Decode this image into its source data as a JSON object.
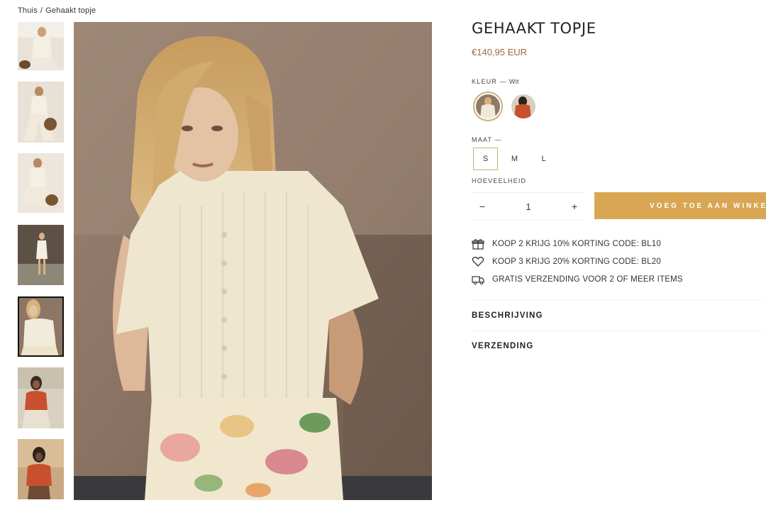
{
  "breadcrumb": {
    "home": "Thuis",
    "separator": "/",
    "current": "Gehaakt topje"
  },
  "product": {
    "title": "GEHAAKT TOPJE",
    "price": "€140,95 EUR"
  },
  "color": {
    "label": "KLEUR —",
    "selected_value": "Wit",
    "options": [
      "Wit",
      "Rood"
    ]
  },
  "size": {
    "label": "MAAT —",
    "options": [
      "S",
      "M",
      "L"
    ],
    "selected": "S"
  },
  "quantity": {
    "label": "HOEVEELHEID",
    "minus": "−",
    "value": "1",
    "plus": "+"
  },
  "add_to_cart": {
    "label": "VOEG TOE AAN WINKELWAGEN"
  },
  "promos": [
    {
      "icon": "gift-icon",
      "text": "KOOP 2 KRIJG 10% KORTING CODE: BL10"
    },
    {
      "icon": "heart-icon",
      "text": "KOOP 3 KRIJG 20% KORTING CODE: BL20"
    },
    {
      "icon": "truck-icon",
      "text": "GRATIS VERZENDING VOOR 2 OF MEER ITEMS"
    }
  ],
  "accordion": {
    "description": "BESCHRIJVING",
    "shipping": "VERZENDING"
  },
  "colors": {
    "accent_gold": "#d9a753",
    "price_brown": "#9a6a3e",
    "swatch_border": "#c8b27a"
  },
  "gallery": {
    "thumbnail_count": 7,
    "active_thumbnail": 5
  }
}
